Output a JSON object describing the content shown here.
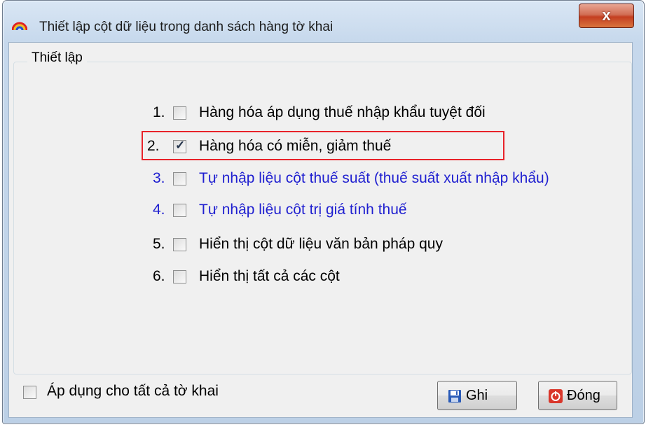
{
  "window": {
    "title": "Thiết lập cột dữ liệu trong danh sách hàng tờ khai",
    "close_label": "x"
  },
  "group": {
    "title": "Thiết lập"
  },
  "options": [
    {
      "num": "1.",
      "label": "Hàng hóa áp dụng thuế nhập khẩu tuyệt đối",
      "checked": false,
      "color": "#000000"
    },
    {
      "num": "2.",
      "label": "Hàng hóa có miễn, giảm thuế",
      "checked": true,
      "color": "#000000"
    },
    {
      "num": "3.",
      "label": "Tự nhập liệu cột thuế suất (thuế suất xuất nhập khẩu)",
      "checked": false,
      "color": "#1f1fd0"
    },
    {
      "num": "4.",
      "label": "Tự nhập liệu cột trị giá tính thuế",
      "checked": false,
      "color": "#1f1fd0"
    },
    {
      "num": "5.",
      "label": "Hiển thị cột dữ liệu văn bản pháp quy",
      "checked": false,
      "color": "#000000"
    },
    {
      "num": "6.",
      "label": "Hiển thị tất cả các cột",
      "checked": false,
      "color": "#000000"
    }
  ],
  "apply_all": {
    "label": "Áp dụng cho tất cả tờ khai",
    "checked": false
  },
  "buttons": {
    "save_label": "Ghi",
    "save_icon": "floppy-disk-icon",
    "close_label": "Đóng",
    "close_icon": "power-icon"
  },
  "colors": {
    "highlight_border": "#e8232a",
    "link_blue": "#1f1fd0"
  }
}
